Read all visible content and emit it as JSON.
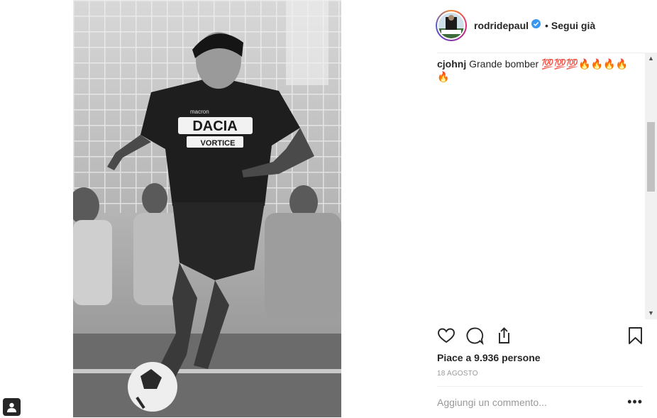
{
  "post": {
    "username": "rodridepaul",
    "separator": "•",
    "follow_status": "Segui già",
    "photo_jersey_sponsor": "DACIA",
    "photo_jersey_subsponsor": "VORTICE",
    "photo_jersey_brand": "macron"
  },
  "comments": [
    {
      "user": "cjohnj",
      "text": "Grande bomber 💯💯💯🔥🔥🔥🔥"
    }
  ],
  "extra_flame": "🔥",
  "likes_text": "Piace a 9.936 persone",
  "date_text": "18 AGOSTO",
  "comment_box": {
    "placeholder": "Aggiungi un commento..."
  },
  "more_label": "•••",
  "colors": {
    "verified": "#3897f0",
    "text": "#262626",
    "muted": "#999999"
  },
  "icons": [
    "heart-icon",
    "comment-icon",
    "share-icon",
    "bookmark-icon",
    "verified-badge-icon",
    "tag-user-icon"
  ]
}
